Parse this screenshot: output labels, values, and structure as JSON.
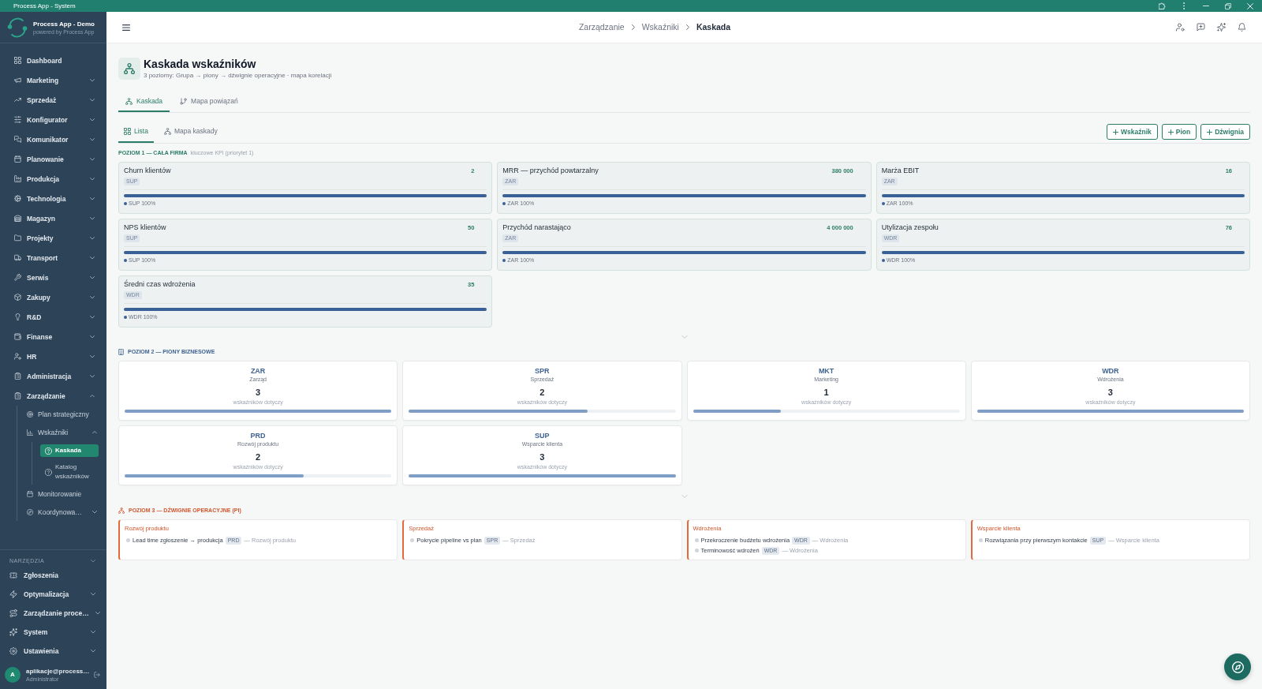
{
  "window": {
    "title": "Process App - System"
  },
  "sidebar": {
    "app_name": "Process App - Demo",
    "app_tagline": "powered by Process App",
    "items": [
      {
        "label": "Dashboard",
        "kind": "link",
        "selected": false
      },
      {
        "label": "Marketing",
        "kind": "group",
        "expanded": false,
        "selected": false
      },
      {
        "label": "Sprzedaż",
        "kind": "group",
        "expanded": false,
        "selected": false
      },
      {
        "label": "Konfigurator",
        "kind": "group",
        "expanded": false,
        "selected": false
      },
      {
        "label": "Komunikator",
        "kind": "group",
        "expanded": false,
        "selected": false
      },
      {
        "label": "Planowanie",
        "kind": "group",
        "expanded": false,
        "selected": false
      },
      {
        "label": "Produkcja",
        "kind": "group",
        "expanded": false,
        "selected": false
      },
      {
        "label": "Technologia",
        "kind": "group",
        "expanded": false,
        "selected": false
      },
      {
        "label": "Magazyn",
        "kind": "group",
        "expanded": false,
        "selected": false
      },
      {
        "label": "Projekty",
        "kind": "group",
        "expanded": false,
        "selected": false
      },
      {
        "label": "Transport",
        "kind": "group",
        "expanded": false,
        "selected": false
      },
      {
        "label": "Serwis",
        "kind": "group",
        "expanded": false,
        "selected": false
      },
      {
        "label": "Zakupy",
        "kind": "group",
        "expanded": false,
        "selected": false
      },
      {
        "label": "R&D",
        "kind": "group",
        "expanded": false,
        "selected": false
      },
      {
        "label": "Finanse",
        "kind": "group",
        "expanded": false,
        "selected": false
      },
      {
        "label": "HR",
        "kind": "group",
        "expanded": false,
        "selected": false
      },
      {
        "label": "Administracja",
        "kind": "group",
        "expanded": false,
        "selected": false
      },
      {
        "label": "Zarządzanie",
        "kind": "group",
        "expanded": true,
        "selected": false,
        "children": [
          {
            "label": "Plan strategiczny",
            "kind": "link",
            "selected": false
          },
          {
            "label": "Wskaźniki",
            "kind": "group",
            "expanded": true,
            "selected": false,
            "children": [
              {
                "label": "Kaskada",
                "kind": "link",
                "selected": true
              },
              {
                "label": "Katalog wskaźników",
                "kind": "link",
                "selected": false
              }
            ]
          },
          {
            "label": "Monitorowanie",
            "kind": "link",
            "selected": false
          },
          {
            "label": "Koordynowa…",
            "kind": "group",
            "expanded": false,
            "selected": false
          }
        ]
      }
    ],
    "tools": {
      "title": "NARZĘDZIA",
      "items": [
        {
          "label": "Zgłoszenia",
          "kind": "link",
          "selected": false
        },
        {
          "label": "Optymalizacja",
          "kind": "group",
          "expanded": false,
          "selected": false
        },
        {
          "label": "Zarządzanie proce…",
          "kind": "group",
          "expanded": false,
          "selected": false
        },
        {
          "label": "System",
          "kind": "group",
          "expanded": false,
          "selected": false
        },
        {
          "label": "Ustawienia",
          "kind": "group",
          "expanded": false,
          "selected": false
        }
      ]
    },
    "user": {
      "initial": "A",
      "name": "aplikacje@process…",
      "role": "Administrator"
    }
  },
  "header": {
    "breadcrumb": [
      {
        "label": "Zarządzanie",
        "current": false
      },
      {
        "label": "Wskaźniki",
        "current": false
      },
      {
        "label": "Kaskada",
        "current": true
      }
    ]
  },
  "page": {
    "title": "Kaskada wskaźników",
    "subtitle": "3 poziomy: Grupa → piony → dźwignie operacyjne · mapa korelacji",
    "tabs": [
      {
        "label": "Kaskada",
        "selected": true
      },
      {
        "label": "Mapa powiązań",
        "selected": false
      }
    ],
    "view_tabs": [
      {
        "label": "Lista",
        "selected": true
      },
      {
        "label": "Mapa kaskady",
        "selected": false
      }
    ],
    "actions": [
      "Wskaźnik",
      "Pion",
      "Dźwignia"
    ],
    "level_1": {
      "title": "POZIOM 1 — CAŁA FIRMA",
      "note": "kluczowe KPI (priorytet 1)",
      "cards": [
        {
          "name": "Churn klientów",
          "value": "2",
          "tag": "SUP",
          "level": 1,
          "legend": "SUP 100%"
        },
        {
          "name": "MRR — przychód powtarzalny",
          "value": "380 000",
          "tag": "ZAR",
          "level": 1,
          "legend": "ZAR 100%"
        },
        {
          "name": "Marża EBIT",
          "value": "16",
          "tag": "ZAR",
          "level": 1,
          "legend": "ZAR 100%"
        },
        {
          "name": "NPS klientów",
          "value": "50",
          "tag": "SUP",
          "level": 1,
          "legend": "SUP 100%"
        },
        {
          "name": "Przychód narastająco",
          "value": "4 000 000",
          "tag": "ZAR",
          "level": 1,
          "legend": "ZAR 100%"
        },
        {
          "name": "Utylizacja zespołu",
          "value": "76",
          "tag": "WDR",
          "level": 1,
          "legend": "WDR 100%"
        },
        {
          "name": "Średni czas wdrożenia",
          "value": "35",
          "tag": "WDR",
          "level": 1,
          "legend": "WDR 100%"
        }
      ]
    },
    "level_2": {
      "title": "POZIOM 2 — PIONY BIZNESOWE",
      "cards": [
        {
          "code": "ZAR",
          "name": "Zarząd",
          "count": "3",
          "caption": "wskaźników dotyczy",
          "level": 1
        },
        {
          "code": "SPR",
          "name": "Sprzedaż",
          "count": "2",
          "caption": "wskaźników dotyczy",
          "level": 0.67
        },
        {
          "code": "MKT",
          "name": "Marketing",
          "count": "1",
          "caption": "wskaźników dotyczy",
          "level": 0.33
        },
        {
          "code": "WDR",
          "name": "Wdrożenia",
          "count": "3",
          "caption": "wskaźników dotyczy",
          "level": 1
        },
        {
          "code": "PRD",
          "name": "Rozwój produktu",
          "count": "2",
          "caption": "wskaźników dotyczy",
          "level": 0.67
        },
        {
          "code": "SUP",
          "name": "Wsparcie klienta",
          "count": "3",
          "caption": "wskaźników dotyczy",
          "level": 1
        }
      ]
    },
    "level_3": {
      "title": "POZIOM 3 — DŹWIGNIE OPERACYJNE (PI)",
      "groups": [
        {
          "title": "Rozwój produktu",
          "items": [
            {
              "name": "Lead time zgłoszenie → produkcja",
              "tag": "PRD",
              "owner": "— Rozwój produktu"
            }
          ]
        },
        {
          "title": "Sprzedaż",
          "items": [
            {
              "name": "Pokrycie pipeline vs plan",
              "tag": "SPR",
              "owner": "— Sprzedaż"
            }
          ]
        },
        {
          "title": "Wdrożenia",
          "items": [
            {
              "name": "Przekroczenie budżetu wdrożenia",
              "tag": "WDR",
              "owner": "— Wdrożenia"
            },
            {
              "name": "Terminowość wdrożeń",
              "tag": "WDR",
              "owner": "— Wdrożenia"
            }
          ]
        },
        {
          "title": "Wsparcie klienta",
          "items": [
            {
              "name": "Rozwiązania przy pierwszym kontakcie",
              "tag": "SUP",
              "owner": "— Wsparcie klienta"
            }
          ]
        }
      ]
    }
  }
}
